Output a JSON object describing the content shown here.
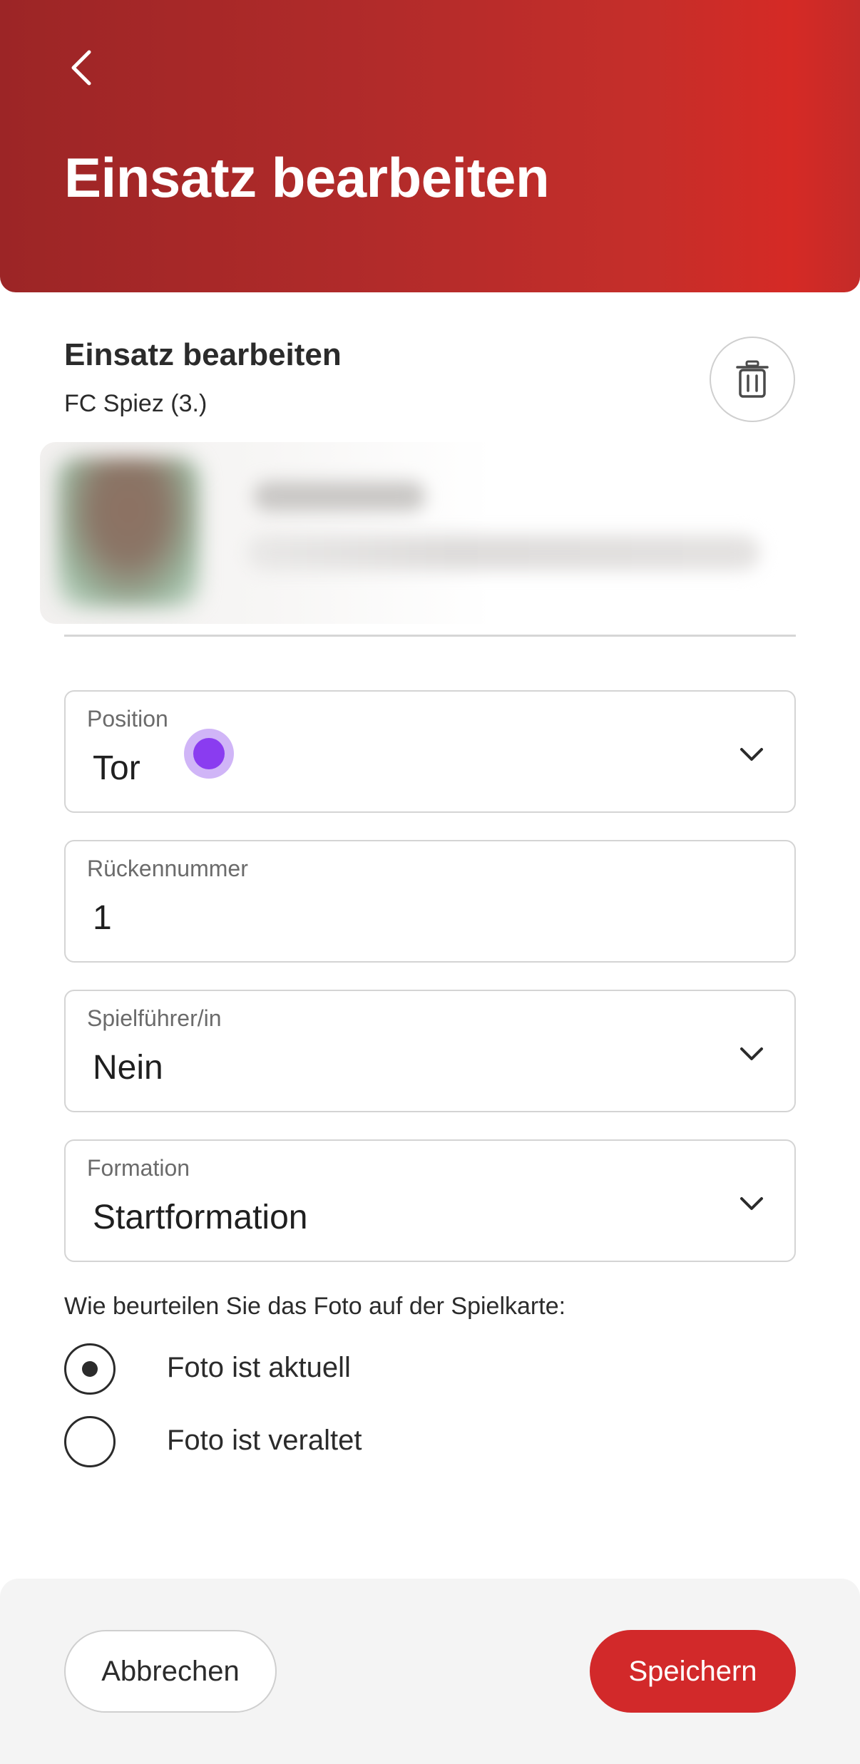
{
  "header": {
    "title": "Einsatz bearbeiten",
    "back_icon": "chevron-left-icon"
  },
  "section": {
    "title": "Einsatz bearbeiten",
    "subtitle": "FC Spiez (3.)",
    "delete_icon": "trash-icon"
  },
  "fields": {
    "position": {
      "label": "Position",
      "value": "Tor"
    },
    "number": {
      "label": "Rückennummer",
      "value": "1"
    },
    "captain": {
      "label": "Spielführer/in",
      "value": "Nein"
    },
    "formation": {
      "label": "Formation",
      "value": "Startformation"
    }
  },
  "photo_rating": {
    "question": "Wie beurteilen Sie das Foto auf der Spielkarte:",
    "options": [
      {
        "label": "Foto ist aktuell",
        "selected": true
      },
      {
        "label": "Foto ist veraltet",
        "selected": false
      }
    ]
  },
  "footer": {
    "cancel_label": "Abbrechen",
    "save_label": "Speichern"
  },
  "colors": {
    "header_start": "#9c2526",
    "header_end": "#d52a25",
    "accent": "#d2292a",
    "touch_indicator": "#8a3cf0"
  }
}
